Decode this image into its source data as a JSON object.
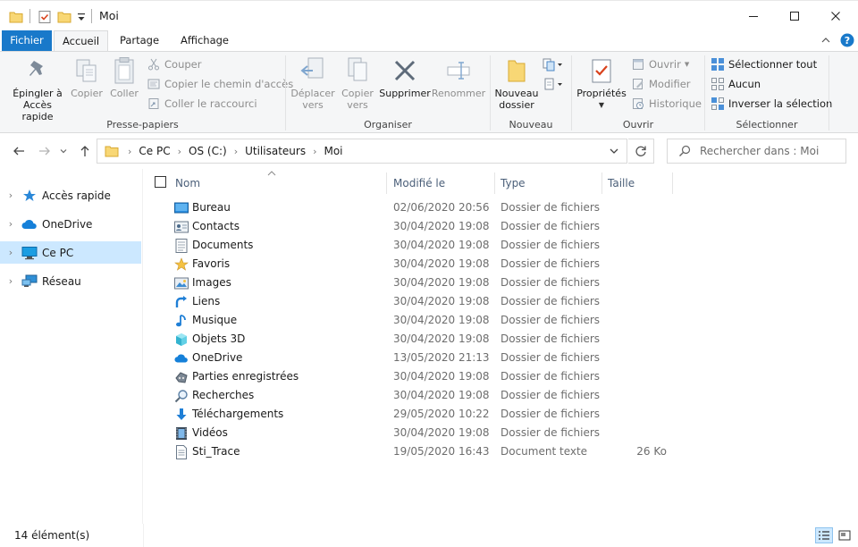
{
  "window": {
    "title": "Moi"
  },
  "ribbon_tabs": [
    "Fichier",
    "Accueil",
    "Partage",
    "Affichage"
  ],
  "ribbon": {
    "clipboard": {
      "label": "Presse-papiers",
      "pin": "Épingler à\nAccès rapide",
      "copy": "Copier",
      "paste": "Coller",
      "cut": "Couper",
      "copy_path": "Copier le chemin d'accès",
      "paste_shortcut": "Coller le raccourci"
    },
    "organize": {
      "label": "Organiser",
      "move_to": "Déplacer\nvers",
      "copy_to": "Copier\nvers",
      "delete": "Supprimer",
      "rename": "Renommer"
    },
    "new": {
      "label": "Nouveau",
      "new_folder": "Nouveau\ndossier"
    },
    "open": {
      "label": "Ouvrir",
      "properties": "Propriétés",
      "open": "Ouvrir",
      "edit": "Modifier",
      "history": "Historique"
    },
    "select": {
      "label": "Sélectionner",
      "select_all": "Sélectionner tout",
      "select_none": "Aucun",
      "invert": "Inverser la sélection"
    }
  },
  "address": {
    "crumbs": [
      "Ce PC",
      "OS (C:)",
      "Utilisateurs",
      "Moi"
    ],
    "search_placeholder": "Rechercher dans : Moi"
  },
  "nav": [
    {
      "label": "Accès rapide",
      "icon": "star-icon",
      "selected": false
    },
    {
      "label": "OneDrive",
      "icon": "cloud-icon",
      "selected": false
    },
    {
      "label": "Ce PC",
      "icon": "computer-icon",
      "selected": true
    },
    {
      "label": "Réseau",
      "icon": "network-icon",
      "selected": false
    }
  ],
  "columns": {
    "name": "Nom",
    "modified": "Modifié le",
    "type": "Type",
    "size": "Taille"
  },
  "files": [
    {
      "name": "Bureau",
      "modified": "02/06/2020 20:56",
      "type": "Dossier de fichiers",
      "size": "",
      "icon": "desktop-icon"
    },
    {
      "name": "Contacts",
      "modified": "30/04/2020 19:08",
      "type": "Dossier de fichiers",
      "size": "",
      "icon": "contacts-icon"
    },
    {
      "name": "Documents",
      "modified": "30/04/2020 19:08",
      "type": "Dossier de fichiers",
      "size": "",
      "icon": "documents-icon"
    },
    {
      "name": "Favoris",
      "modified": "30/04/2020 19:08",
      "type": "Dossier de fichiers",
      "size": "",
      "icon": "star-icon"
    },
    {
      "name": "Images",
      "modified": "30/04/2020 19:08",
      "type": "Dossier de fichiers",
      "size": "",
      "icon": "pictures-icon"
    },
    {
      "name": "Liens",
      "modified": "30/04/2020 19:08",
      "type": "Dossier de fichiers",
      "size": "",
      "icon": "link-arrow-icon"
    },
    {
      "name": "Musique",
      "modified": "30/04/2020 19:08",
      "type": "Dossier de fichiers",
      "size": "",
      "icon": "music-note-icon"
    },
    {
      "name": "Objets 3D",
      "modified": "30/04/2020 19:08",
      "type": "Dossier de fichiers",
      "size": "",
      "icon": "cube-icon"
    },
    {
      "name": "OneDrive",
      "modified": "13/05/2020 21:13",
      "type": "Dossier de fichiers",
      "size": "",
      "icon": "cloud-icon"
    },
    {
      "name": "Parties enregistrées",
      "modified": "30/04/2020 19:08",
      "type": "Dossier de fichiers",
      "size": "",
      "icon": "saved-games-icon"
    },
    {
      "name": "Recherches",
      "modified": "30/04/2020 19:08",
      "type": "Dossier de fichiers",
      "size": "",
      "icon": "search-icon"
    },
    {
      "name": "Téléchargements",
      "modified": "29/05/2020 10:22",
      "type": "Dossier de fichiers",
      "size": "",
      "icon": "download-arrow-icon"
    },
    {
      "name": "Vidéos",
      "modified": "30/04/2020 19:08",
      "type": "Dossier de fichiers",
      "size": "",
      "icon": "video-icon"
    },
    {
      "name": "Sti_Trace",
      "modified": "19/05/2020 16:43",
      "type": "Document texte",
      "size": "26 Ko",
      "icon": "text-file-icon"
    }
  ],
  "status": {
    "count": "14 élément(s)"
  },
  "colors": {
    "accent": "#1979ca",
    "selection": "#cce8ff",
    "header_text": "#4c607a"
  }
}
